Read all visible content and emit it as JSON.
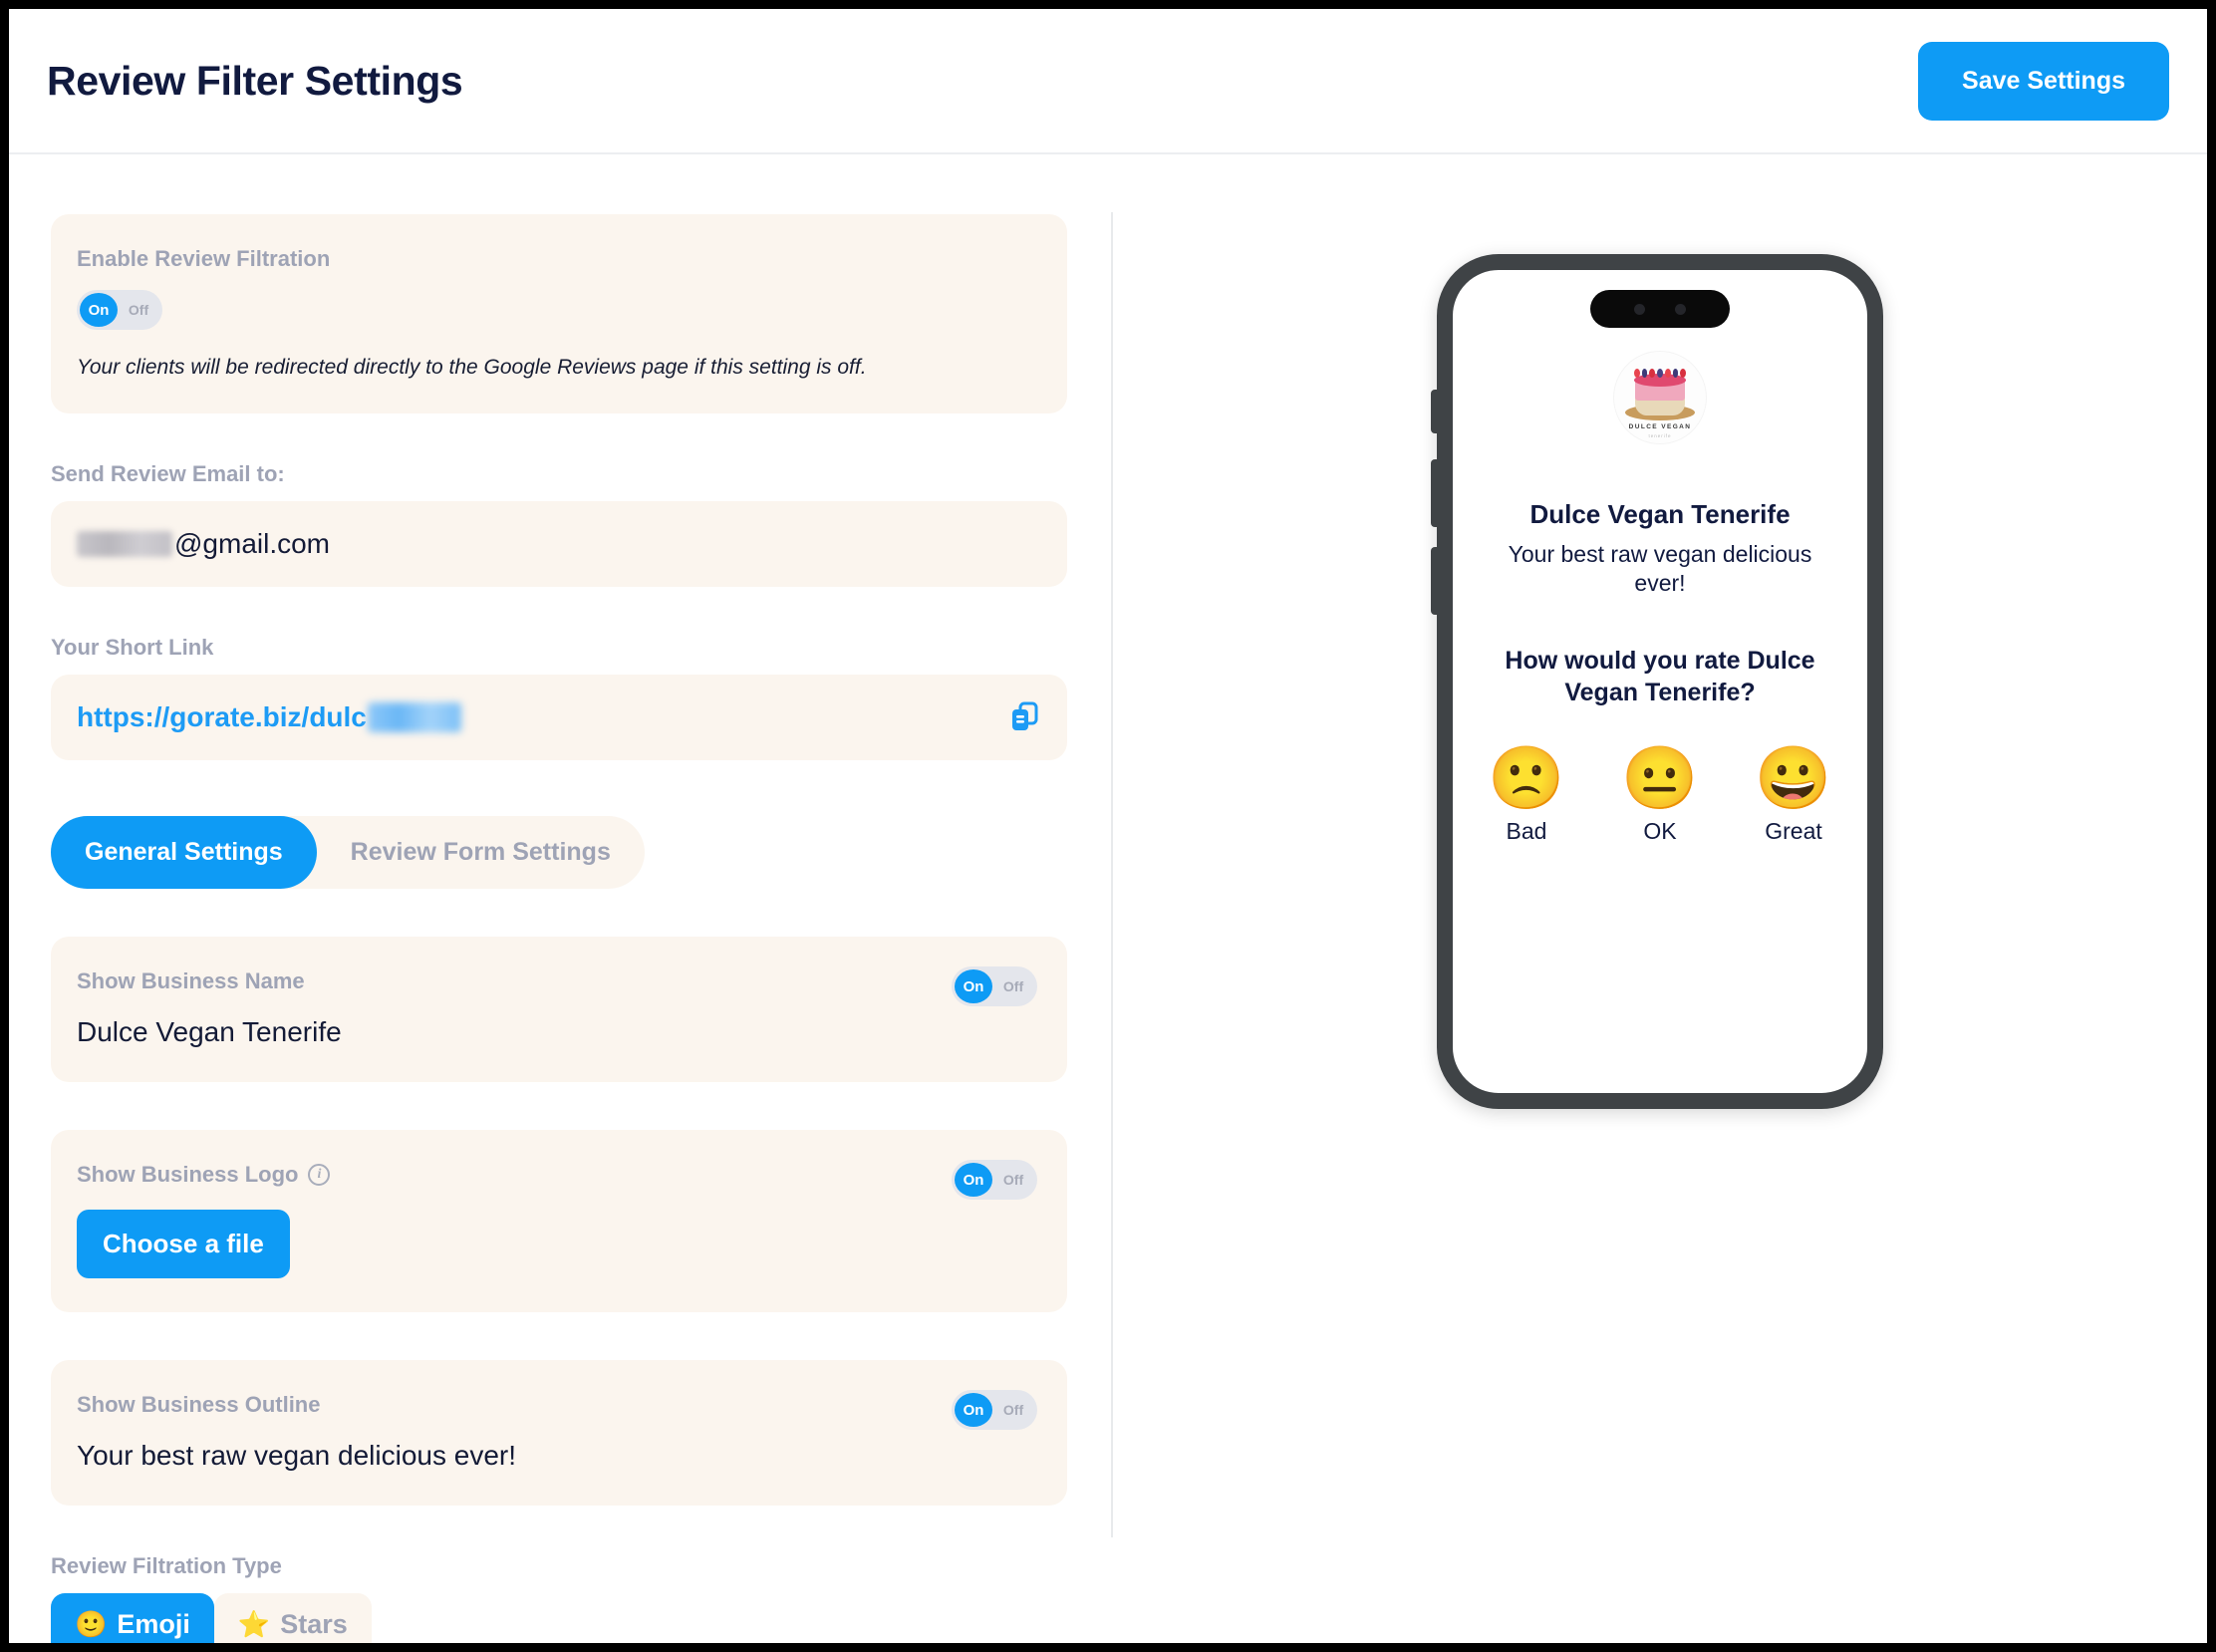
{
  "header": {
    "title": "Review Filter Settings",
    "save_label": "Save Settings"
  },
  "settings": {
    "enable_filtration": {
      "label": "Enable Review Filtration",
      "toggle_on": "On",
      "toggle_off": "Off",
      "state": "On",
      "note": "Your clients will be redirected directly to the Google Reviews page if this setting is off."
    },
    "email": {
      "label": "Send Review Email to:",
      "value_suffix": "@gmail.com",
      "value_redacted": true
    },
    "short_link": {
      "label": "Your Short Link",
      "value_prefix": "https://gorate.biz/dulc",
      "value_redacted": true,
      "copy_icon": "copy-icon"
    },
    "tabs": [
      {
        "label": "General Settings",
        "active": true
      },
      {
        "label": "Review Form Settings",
        "active": false
      }
    ],
    "show_business_name": {
      "label": "Show Business Name",
      "value": "Dulce Vegan Tenerife",
      "toggle_on": "On",
      "toggle_off": "Off",
      "state": "On"
    },
    "show_business_logo": {
      "label": "Show Business Logo",
      "info_icon": "info-icon",
      "button_label": "Choose a file",
      "toggle_on": "On",
      "toggle_off": "Off",
      "state": "On"
    },
    "show_business_outline": {
      "label": "Show Business Outline",
      "value": "Your best raw vegan delicious ever!",
      "toggle_on": "On",
      "toggle_off": "Off",
      "state": "On"
    },
    "filtration_type": {
      "label": "Review Filtration Type",
      "options": [
        {
          "label": "Emoji",
          "icon": "🙂",
          "active": true
        },
        {
          "label": "Stars",
          "icon": "⭐",
          "active": false
        }
      ]
    }
  },
  "preview": {
    "logo": {
      "brand_text": "DULCE VEGAN",
      "brand_sub": "tenerife"
    },
    "business_name": "Dulce Vegan Tenerife",
    "outline": "Your best raw vegan delicious ever!",
    "question": "How would you rate Dulce Vegan Tenerife?",
    "ratings": [
      {
        "face": "🙁",
        "label": "Bad"
      },
      {
        "face": "😐",
        "label": "OK"
      },
      {
        "face": "😀",
        "label": "Great"
      }
    ]
  },
  "colors": {
    "accent": "#0e9bf5",
    "card_bg": "#fbf5ee",
    "title": "#111a3f",
    "muted": "#9ea3b5"
  }
}
